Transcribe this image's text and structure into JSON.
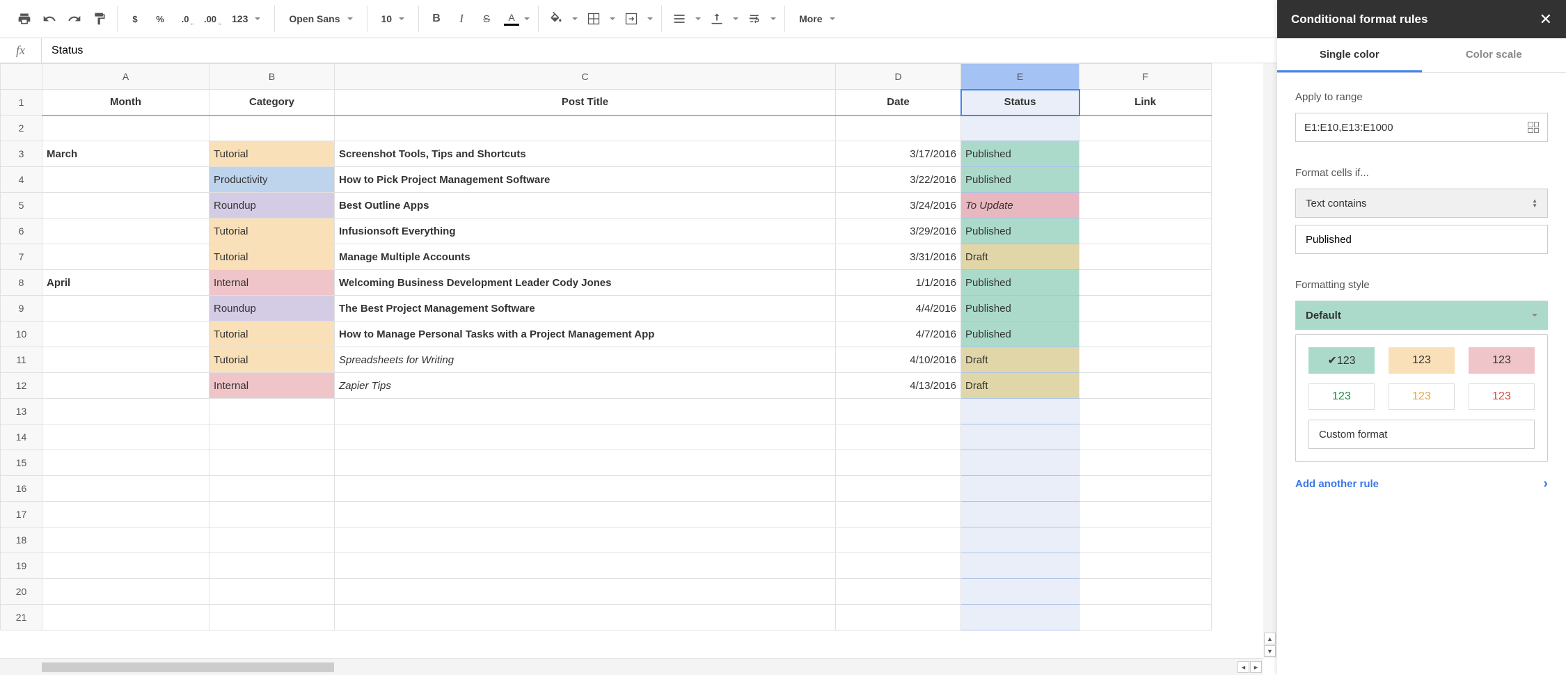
{
  "toolbar": {
    "font": "Open Sans",
    "fontSize": "10",
    "more": "More",
    "fmtButtons": [
      "$",
      "%",
      ".0",
      ".00",
      "123"
    ]
  },
  "fx": {
    "value": "Status"
  },
  "columns": [
    "A",
    "B",
    "C",
    "D",
    "E",
    "F"
  ],
  "headers": {
    "A": "Month",
    "B": "Category",
    "C": "Post Title",
    "D": "Date",
    "E": "Status",
    "F": "Link"
  },
  "rows": [
    {
      "n": 2
    },
    {
      "n": 3,
      "month": "March",
      "cat": "Tutorial",
      "catCls": "cat-tutorial",
      "title": "Screenshot Tools, Tips and Shortcuts",
      "date": "3/17/2016",
      "status": "Published",
      "stCls": "st-published"
    },
    {
      "n": 4,
      "cat": "Productivity",
      "catCls": "cat-productivity",
      "title": "How to Pick Project Management Software",
      "date": "3/22/2016",
      "status": "Published",
      "stCls": "st-published"
    },
    {
      "n": 5,
      "cat": "Roundup",
      "catCls": "cat-roundup",
      "title": "Best Outline Apps",
      "date": "3/24/2016",
      "status": "To Update",
      "stCls": "st-toupdate"
    },
    {
      "n": 6,
      "cat": "Tutorial",
      "catCls": "cat-tutorial",
      "title": "Infusionsoft Everything",
      "date": "3/29/2016",
      "status": "Published",
      "stCls": "st-published"
    },
    {
      "n": 7,
      "cat": "Tutorial",
      "catCls": "cat-tutorial",
      "title": "Manage Multiple Accounts",
      "date": "3/31/2016",
      "status": "Draft",
      "stCls": "st-draft"
    },
    {
      "n": 8,
      "month": "April",
      "cat": "Internal",
      "catCls": "cat-internal",
      "title": "Welcoming Business Development Leader Cody Jones",
      "date": "1/1/2016",
      "status": "Published",
      "stCls": "st-published"
    },
    {
      "n": 9,
      "cat": "Roundup",
      "catCls": "cat-roundup",
      "title": "The Best Project Management Software",
      "date": "4/4/2016",
      "status": "Published",
      "stCls": "st-published"
    },
    {
      "n": 10,
      "cat": "Tutorial",
      "catCls": "cat-tutorial",
      "title": "How to Manage Personal Tasks with a Project Management App",
      "date": "4/7/2016",
      "status": "Published",
      "stCls": "st-published"
    },
    {
      "n": 11,
      "cat": "Tutorial",
      "catCls": "cat-tutorial",
      "title": "Spreadsheets for Writing",
      "ital": true,
      "date": "4/10/2016",
      "status": "Draft",
      "stCls": "st-draft"
    },
    {
      "n": 12,
      "cat": "Internal",
      "catCls": "cat-internal",
      "title": "Zapier Tips",
      "ital": true,
      "date": "4/13/2016",
      "status": "Draft",
      "stCls": "st-draft"
    },
    {
      "n": 13
    },
    {
      "n": 14
    },
    {
      "n": 15
    },
    {
      "n": 16
    },
    {
      "n": 17
    },
    {
      "n": 18
    },
    {
      "n": 19
    },
    {
      "n": 20
    },
    {
      "n": 21
    }
  ],
  "panel": {
    "title": "Conditional format rules",
    "tabs": {
      "single": "Single color",
      "scale": "Color scale"
    },
    "applyLabel": "Apply to range",
    "range": "E1:E10,E13:E1000",
    "formatIfLabel": "Format cells if...",
    "condition": "Text contains",
    "conditionValue": "Published",
    "styleLabel": "Formatting style",
    "styleDefault": "Default",
    "swatchText": "123",
    "swatchCheck": "✔123",
    "customFormat": "Custom format",
    "addRule": "Add another rule"
  }
}
